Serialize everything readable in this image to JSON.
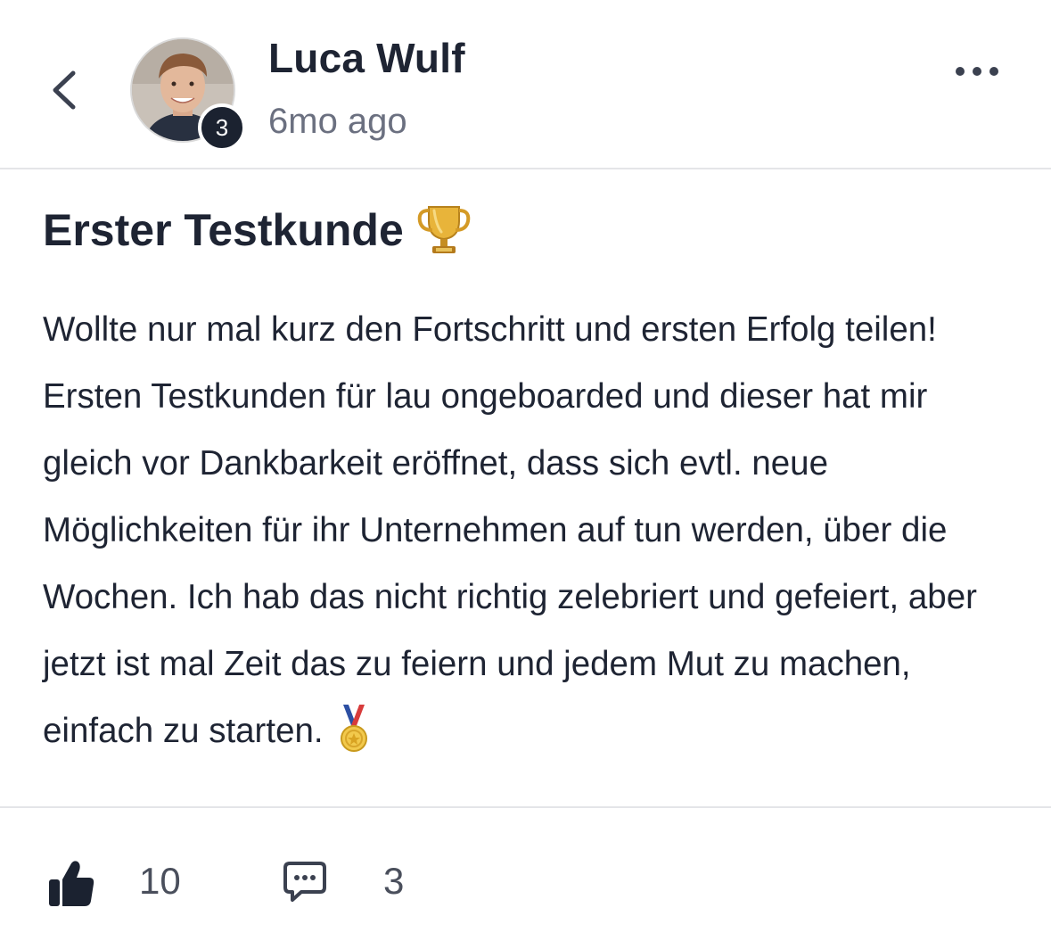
{
  "header": {
    "back_icon": "chevron-left-icon",
    "author_name": "Luca Wulf",
    "level": "3",
    "time_ago": "6mo ago",
    "more_icon": "more-horizontal-icon"
  },
  "post": {
    "title": "Erster Testkunde",
    "title_emoji": "trophy-emoji",
    "body": "Wollte nur mal kurz den Fortschritt und ersten Erfolg teilen! Ersten Testkunden für lau ongeboarded und dieser hat mir gleich vor Dankbarkeit eröffnet, dass sich evtl. neue Möglichkeiten für ihr Unternehmen auf tun werden, über die Wochen. Ich hab das nicht richtig zelebriert und gefeiert, aber jetzt ist mal Zeit das zu feiern und jedem Mut zu machen, einfach zu starten.",
    "body_emoji": "medal-emoji"
  },
  "footer": {
    "like_icon": "thumbs-up-icon",
    "like_count": "10",
    "comment_icon": "comment-icon",
    "comment_count": "3"
  },
  "colors": {
    "text": "#1e2433",
    "muted": "#6b7080",
    "badge": "#1b2230",
    "divider": "#e4e5e8"
  }
}
